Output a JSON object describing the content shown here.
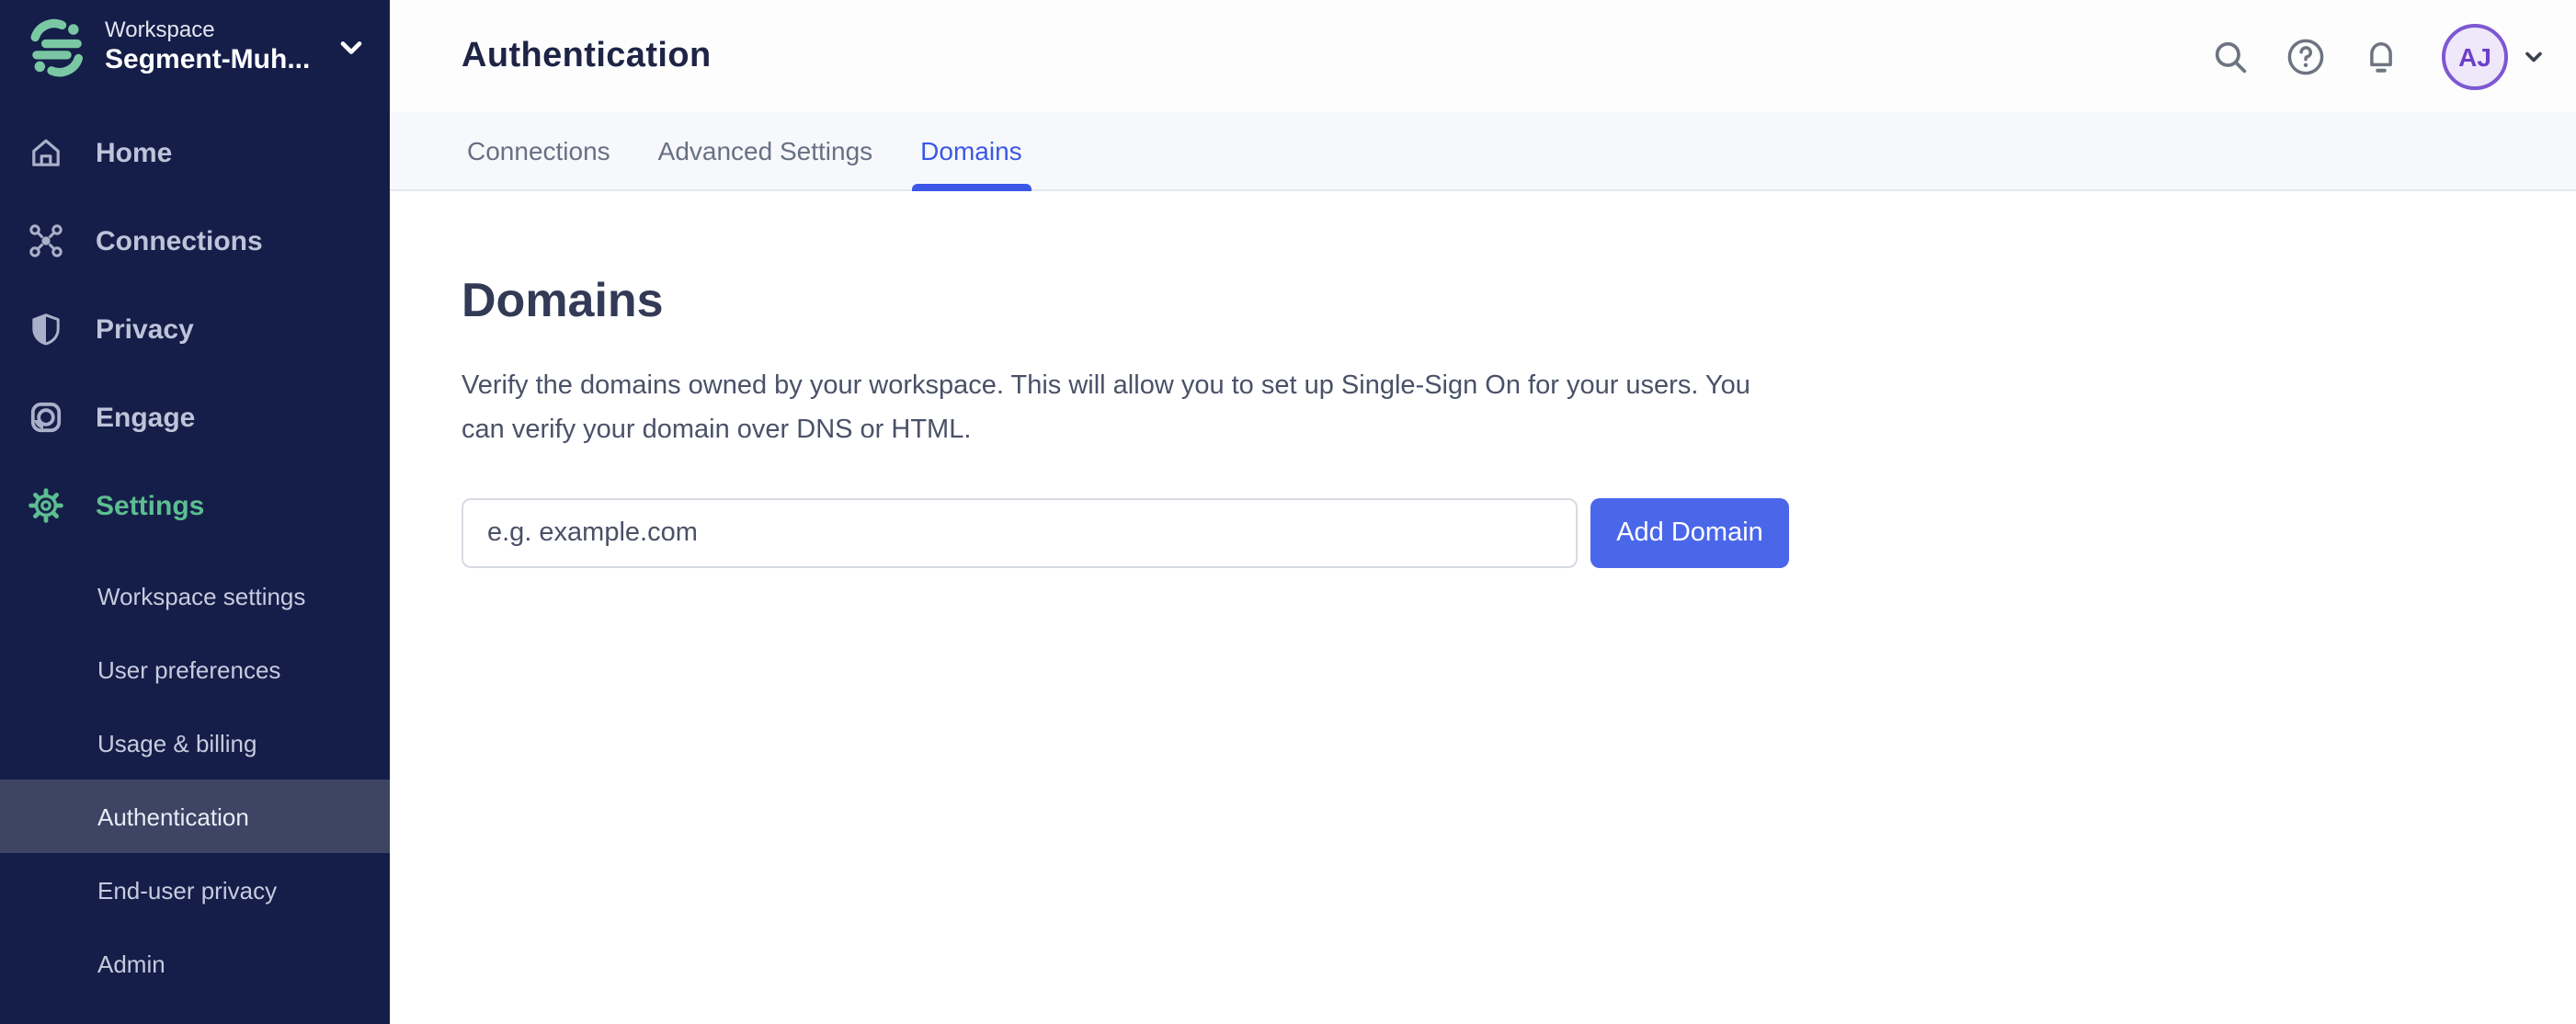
{
  "colors": {
    "sidebar_bg": "#151E49",
    "sidebar_selected_bg": "#3D4464",
    "accent_green": "#5CBE90",
    "logo_green": "#7AC8A3",
    "active_tab_blue": "#3A57E8",
    "button_blue": "#4A67EA",
    "avatar_border_purple": "#7E57D2",
    "avatar_bg": "#EEE8FA",
    "avatar_text": "#6C40C9"
  },
  "sidebar": {
    "workspace": {
      "label": "Workspace",
      "name": "Segment-Muh..."
    },
    "items": [
      {
        "label": "Home",
        "icon": "home-icon"
      },
      {
        "label": "Connections",
        "icon": "connections-icon"
      },
      {
        "label": "Privacy",
        "icon": "shield-icon"
      },
      {
        "label": "Engage",
        "icon": "engage-icon"
      },
      {
        "label": "Settings",
        "icon": "gear-icon",
        "active": true
      }
    ],
    "settings_items": [
      {
        "label": "Workspace settings"
      },
      {
        "label": "User preferences"
      },
      {
        "label": "Usage & billing"
      },
      {
        "label": "Authentication",
        "selected": true
      },
      {
        "label": "End-user privacy"
      },
      {
        "label": "Admin"
      }
    ]
  },
  "header": {
    "title": "Authentication",
    "tabs": [
      {
        "label": "Connections"
      },
      {
        "label": "Advanced Settings"
      },
      {
        "label": "Domains",
        "active": true
      }
    ],
    "actions": {
      "icons": [
        "search-icon",
        "help-icon",
        "notifications-icon",
        "chevron-down-icon"
      ],
      "avatar_initials": "AJ"
    }
  },
  "main": {
    "heading": "Domains",
    "description": "Verify the domains owned by your workspace. This will allow you to set up Single-Sign On for your users. You can verify your domain over DNS or HTML.",
    "domain_input": {
      "value": "",
      "placeholder": "e.g. example.com"
    },
    "add_domain_button": "Add Domain"
  }
}
